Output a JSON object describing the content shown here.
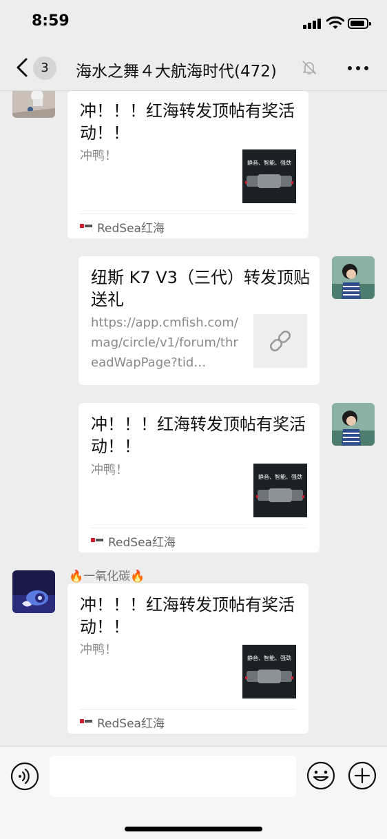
{
  "status_bar": {
    "time": "8:59"
  },
  "header": {
    "unread_count": "3",
    "title": "海水之舞４大航海时代(472)"
  },
  "messages": [
    {
      "side": "left",
      "sender": "",
      "title": "冲！！！红海转发顶帖有奖活动！！",
      "desc": "冲鸭！",
      "thumb_text": "静音、智能、强劲",
      "source": "RedSea红海"
    },
    {
      "side": "right",
      "title": "纽斯 K7 V3（三代）转发顶贴送礼",
      "desc": "https://app.cmfish.com/mag/circle/v1/forum/threadWapPage?tid…",
      "thumb_icon": "link-icon"
    },
    {
      "side": "right",
      "title": "冲！！！红海转发顶帖有奖活动！！",
      "desc": "冲鸭！",
      "thumb_text": "静音、智能、强劲",
      "source": "RedSea红海"
    },
    {
      "side": "left",
      "sender": "🔥一氧化碳🔥",
      "title": "冲！！！红海转发顶帖有奖活动！！",
      "desc": "冲鸭！",
      "thumb_text": "静音、智能、强劲",
      "source": "RedSea红海"
    }
  ],
  "colors": {
    "background": "#ededed",
    "bubble": "#ffffff",
    "thumb_dark": "#1c1f24"
  },
  "icons": [
    "back-chevron-icon",
    "mute-bell-icon",
    "more-dots-icon",
    "voice-icon",
    "emoji-icon",
    "plus-icon",
    "link-icon"
  ]
}
